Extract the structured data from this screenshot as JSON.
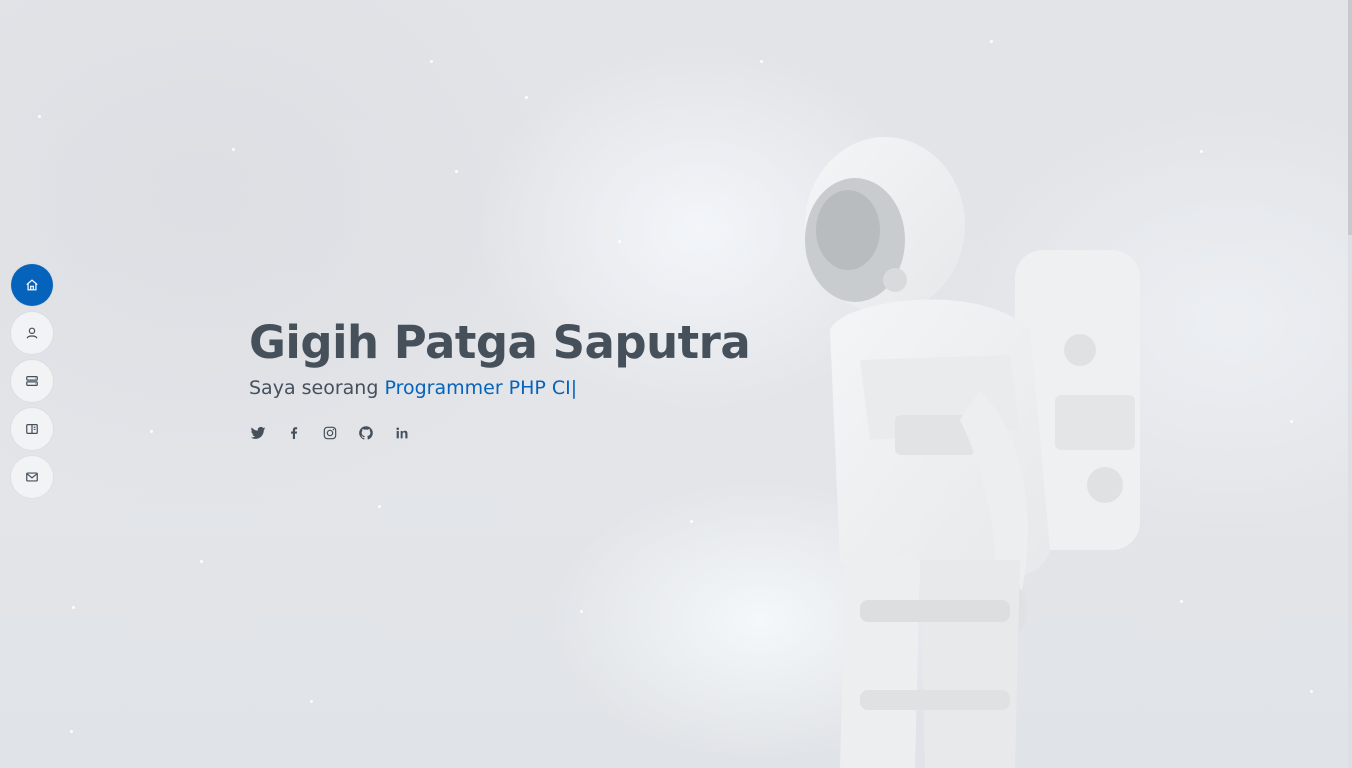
{
  "hero": {
    "name": "Gigih Patga Saputra",
    "tagline_prefix": "Saya seorang",
    "tagline_typed": "Programmer PHP CI",
    "caret": "|"
  },
  "nav": {
    "items": [
      {
        "icon": "home-icon",
        "active": true
      },
      {
        "icon": "person-icon",
        "active": false
      },
      {
        "icon": "server-icon",
        "active": false
      },
      {
        "icon": "book-icon",
        "active": false
      },
      {
        "icon": "envelope-icon",
        "active": false
      }
    ]
  },
  "socials": [
    {
      "icon": "twitter-icon"
    },
    {
      "icon": "facebook-icon"
    },
    {
      "icon": "instagram-icon"
    },
    {
      "icon": "github-icon"
    },
    {
      "icon": "linkedin-icon"
    }
  ],
  "colors": {
    "accent": "#0563bb",
    "text": "#45505b",
    "background": "#e4e6ea"
  }
}
